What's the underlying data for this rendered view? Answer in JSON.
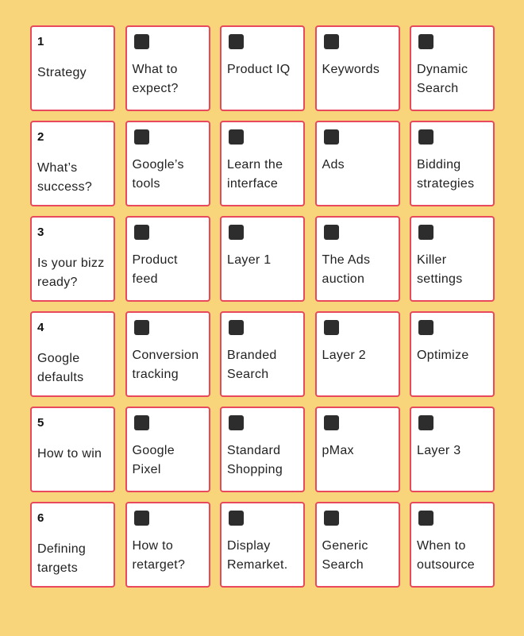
{
  "colors": {
    "background": "#f8d47a",
    "card_border": "#e8495c",
    "card_fill": "#ffffff",
    "checkbox": "#2d2d2d"
  },
  "rows": [
    {
      "step": "1",
      "step_label": "Strategy",
      "items": [
        "What to\nexpect?",
        "Product IQ",
        "Keywords",
        "Dynamic\nSearch"
      ]
    },
    {
      "step": "2",
      "step_label": "What’s\nsuccess?",
      "items": [
        "Google’s\ntools",
        "Learn the\ninterface",
        "Ads",
        "Bidding\nstrategies"
      ]
    },
    {
      "step": "3",
      "step_label": "Is your bizz\nready?",
      "items": [
        "Product\nfeed",
        "Layer 1",
        "The Ads\nauction",
        "Killer\nsettings"
      ]
    },
    {
      "step": "4",
      "step_label": "Google\ndefaults",
      "items": [
        "Conversion\ntracking",
        "Branded\nSearch",
        "Layer 2",
        "Optimize"
      ]
    },
    {
      "step": "5",
      "step_label": "How to win",
      "items": [
        "Google\nPixel",
        "Standard\nShopping",
        "pMax",
        "Layer 3"
      ]
    },
    {
      "step": "6",
      "step_label": "Defining\ntargets",
      "items": [
        "How to\nretarget?",
        "Display\nRemarket.",
        "Generic\nSearch",
        "When to\noutsource"
      ]
    }
  ]
}
